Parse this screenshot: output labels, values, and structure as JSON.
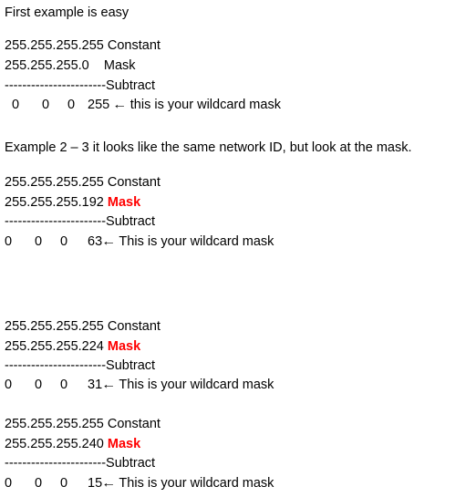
{
  "intro": "First example is easy",
  "example1": {
    "constant_value": "255.255.255.255",
    "constant_label": "Constant",
    "mask_value": "255.255.255.0",
    "mask_label": "Mask",
    "divider": "-----------------------Subtract",
    "result": [
      "0",
      "0",
      "0",
      "255"
    ],
    "arrow": "🡠",
    "result_label": "this is your wildcard mask"
  },
  "example2_heading": "Example 2 – 3 it looks like the same network ID, but look at the mask.",
  "examples": [
    {
      "constant_value": "255.255.255.255",
      "constant_label": "Constant",
      "mask_value": "255.255.255.192",
      "mask_label": "Mask",
      "divider": "-----------------------Subtract",
      "result": [
        "0",
        "0",
        "0",
        "63"
      ],
      "arrow": "🡠",
      "result_label": "This is your wildcard mask"
    },
    {
      "constant_value": "255.255.255.255",
      "constant_label": "Constant",
      "mask_value": "255.255.255.224",
      "mask_label": "Mask",
      "divider": "-----------------------Subtract",
      "result": [
        "0",
        "0",
        "0",
        "31"
      ],
      "arrow": "🡠",
      "result_label": "This is your wildcard mask"
    },
    {
      "constant_value": "255.255.255.255",
      "constant_label": "Constant",
      "mask_value": "255.255.255.240",
      "mask_label": "Mask",
      "divider": "-----------------------Subtract",
      "result": [
        "0",
        "0",
        "0",
        "15"
      ],
      "arrow": "🡠",
      "result_label": "This is your wildcard mask"
    }
  ],
  "colors": {
    "mask_highlight": "#ff0000",
    "text": "#000000"
  }
}
